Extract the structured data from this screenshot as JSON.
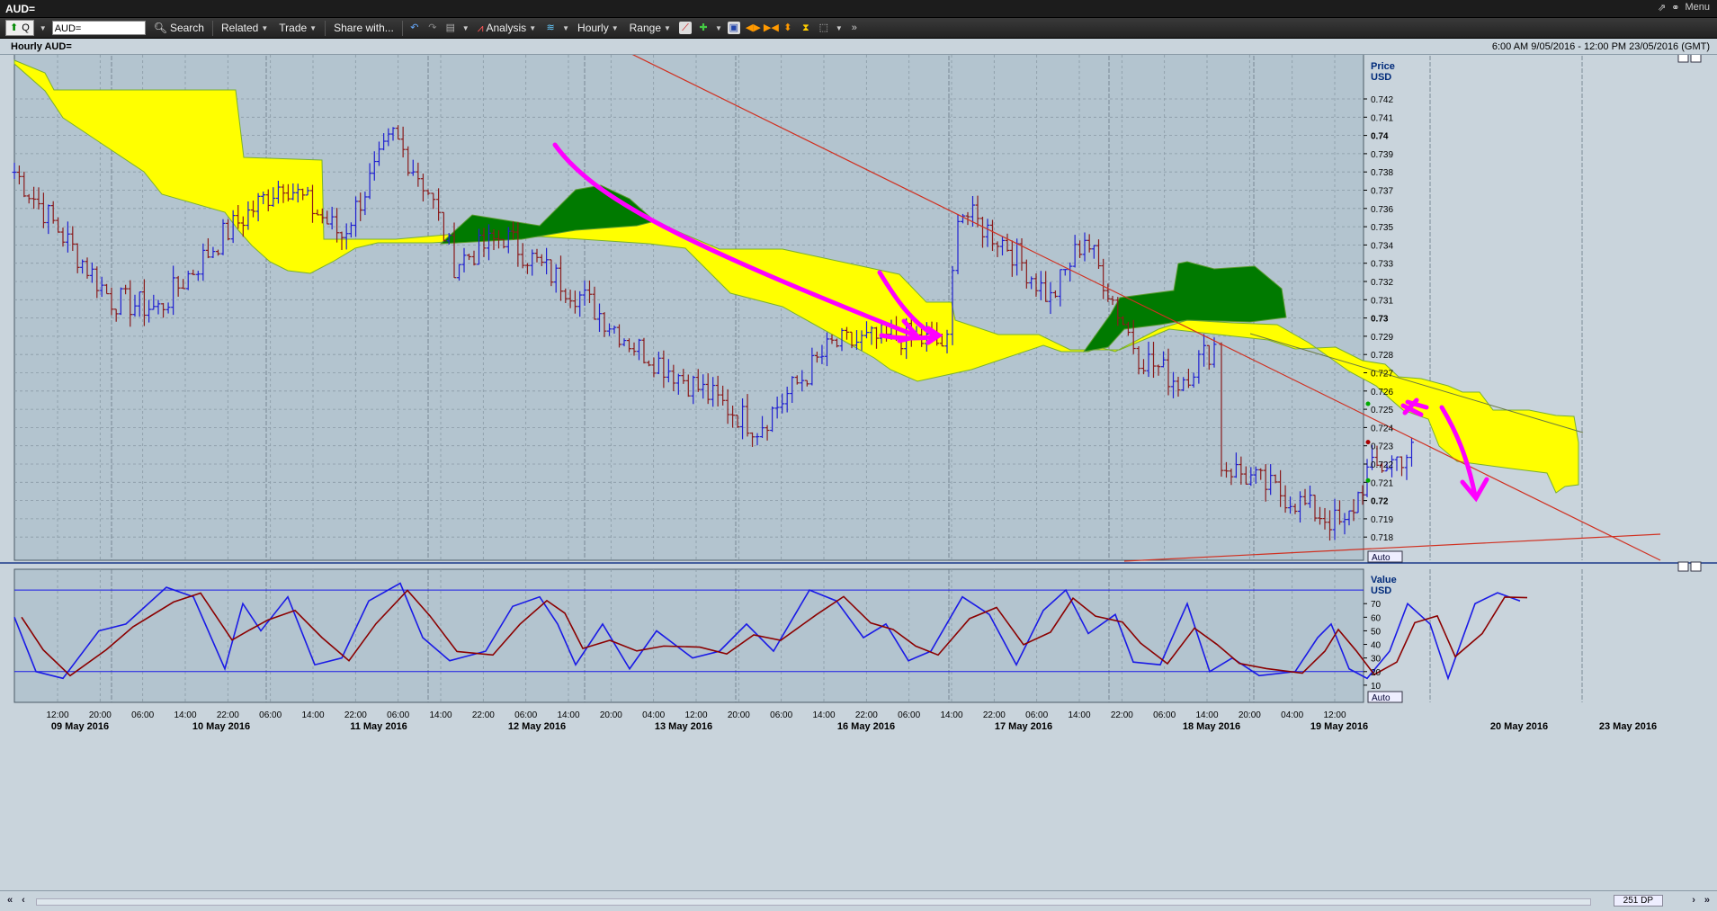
{
  "window": {
    "title": "AUD=",
    "menu_label": "Menu"
  },
  "toolbar": {
    "q_label": "Q",
    "ric_value": "AUD=",
    "search": "Search",
    "related": "Related",
    "trade": "Trade",
    "share": "Share with...",
    "analysis": "Analysis",
    "interval": "Hourly",
    "range": "Range"
  },
  "chart_header": {
    "left": "Hourly AUD=",
    "right": "6:00 AM 9/05/2016 - 12:00 PM 23/05/2016 (GMT)"
  },
  "colors": {
    "plot_bg": "#b3c4cf",
    "grid": "#8a9aa6",
    "cloud_bull": "#ffff00",
    "cloud_bear": "#007a00",
    "up": "#2020d0",
    "down": "#8a1c1c",
    "trend": "#d03020",
    "annot": "#ff00ff",
    "stoch_k": "#1a1ae6",
    "stoch_d": "#8b0000"
  },
  "price_axis": {
    "title": "Price",
    "unit": "USD",
    "scale_button": "Auto",
    "ticks": [
      "0.742",
      "0.741",
      "0.74",
      "0.739",
      "0.738",
      "0.737",
      "0.736",
      "0.735",
      "0.734",
      "0.733",
      "0.732",
      "0.731",
      "0.73",
      "0.729",
      "0.728",
      "0.727",
      "0.726",
      "0.725",
      "0.724",
      "0.723",
      "0.722",
      "0.721",
      "0.72",
      "0.719",
      "0.718"
    ]
  },
  "osc_axis": {
    "title": "Value",
    "unit": "USD",
    "scale_button": "Auto",
    "ticks": [
      "70",
      "60",
      "50",
      "40",
      "30",
      "20",
      "10"
    ]
  },
  "time_axis": {
    "hour_labels": [
      "12:00",
      "20:00",
      "06:00",
      "14:00",
      "22:00",
      "06:00",
      "14:00",
      "22:00",
      "06:00",
      "14:00",
      "22:00",
      "06:00",
      "14:00",
      "20:00",
      "04:00",
      "12:00",
      "20:00",
      "06:00",
      "14:00",
      "22:00",
      "06:00",
      "14:00",
      "22:00",
      "06:00",
      "14:00",
      "22:00",
      "06:00",
      "14:00",
      "20:00",
      "04:00",
      "12:00"
    ],
    "date_labels": [
      "09 May 2016",
      "10 May 2016",
      "11 May 2016",
      "12 May 2016",
      "13 May 2016",
      "16 May 2016",
      "17 May 2016",
      "18 May 2016",
      "19 May 2016",
      "20 May 2016",
      "23 May 2016"
    ]
  },
  "status": {
    "dp_label": "251 DP"
  },
  "chart_data": [
    {
      "type": "candlestick",
      "title": "Hourly AUD=",
      "series": [
        "AUD= hourly OHLC bars",
        "Ichimoku cloud"
      ],
      "y_unit": "USD",
      "ylim": [
        0.7172,
        0.7432
      ],
      "x_range": [
        "9 May 2016 06:00",
        "23 May 2016 12:00"
      ],
      "approx_close_path": [
        {
          "x": "09 May 06:00",
          "y": 0.738
        },
        {
          "x": "09 May 14:00",
          "y": 0.731
        },
        {
          "x": "10 May 00:00",
          "y": 0.7305
        },
        {
          "x": "10 May 12:00",
          "y": 0.7345
        },
        {
          "x": "10 May 22:00",
          "y": 0.7375
        },
        {
          "x": "11 May 08:00",
          "y": 0.7345
        },
        {
          "x": "11 May 14:00",
          "y": 0.74
        },
        {
          "x": "11 May 22:00",
          "y": 0.737
        },
        {
          "x": "12 May 04:00",
          "y": 0.733
        },
        {
          "x": "12 May 12:00",
          "y": 0.7345
        },
        {
          "x": "12 May 18:00",
          "y": 0.733
        },
        {
          "x": "13 May 02:00",
          "y": 0.731
        },
        {
          "x": "13 May 10:00",
          "y": 0.7285
        },
        {
          "x": "13 May 20:00",
          "y": 0.724
        },
        {
          "x": "16 May 04:00",
          "y": 0.7285
        },
        {
          "x": "16 May 14:00",
          "y": 0.729
        },
        {
          "x": "16 May 22:00",
          "y": 0.7285
        },
        {
          "x": "17 May 00:00",
          "y": 0.736
        },
        {
          "x": "17 May 08:00",
          "y": 0.734
        },
        {
          "x": "17 May 14:00",
          "y": 0.731
        },
        {
          "x": "17 May 20:00",
          "y": 0.7345
        },
        {
          "x": "18 May 02:00",
          "y": 0.731
        },
        {
          "x": "18 May 06:00",
          "y": 0.728
        },
        {
          "x": "18 May 12:00",
          "y": 0.7265
        },
        {
          "x": "18 May 18:00",
          "y": 0.7285
        },
        {
          "x": "19 May 00:00",
          "y": 0.722
        },
        {
          "x": "19 May 08:00",
          "y": 0.72
        },
        {
          "x": "19 May 14:00",
          "y": 0.7185
        },
        {
          "x": "19 May 18:00",
          "y": 0.7215
        },
        {
          "x": "20 May 00:00",
          "y": 0.7228
        }
      ]
    },
    {
      "type": "line",
      "title": "Stochastic oscillator",
      "series": [
        {
          "name": "%K"
        },
        {
          "name": "%D"
        }
      ],
      "ylim": [
        0,
        90
      ],
      "levels": [
        80,
        20
      ]
    }
  ]
}
